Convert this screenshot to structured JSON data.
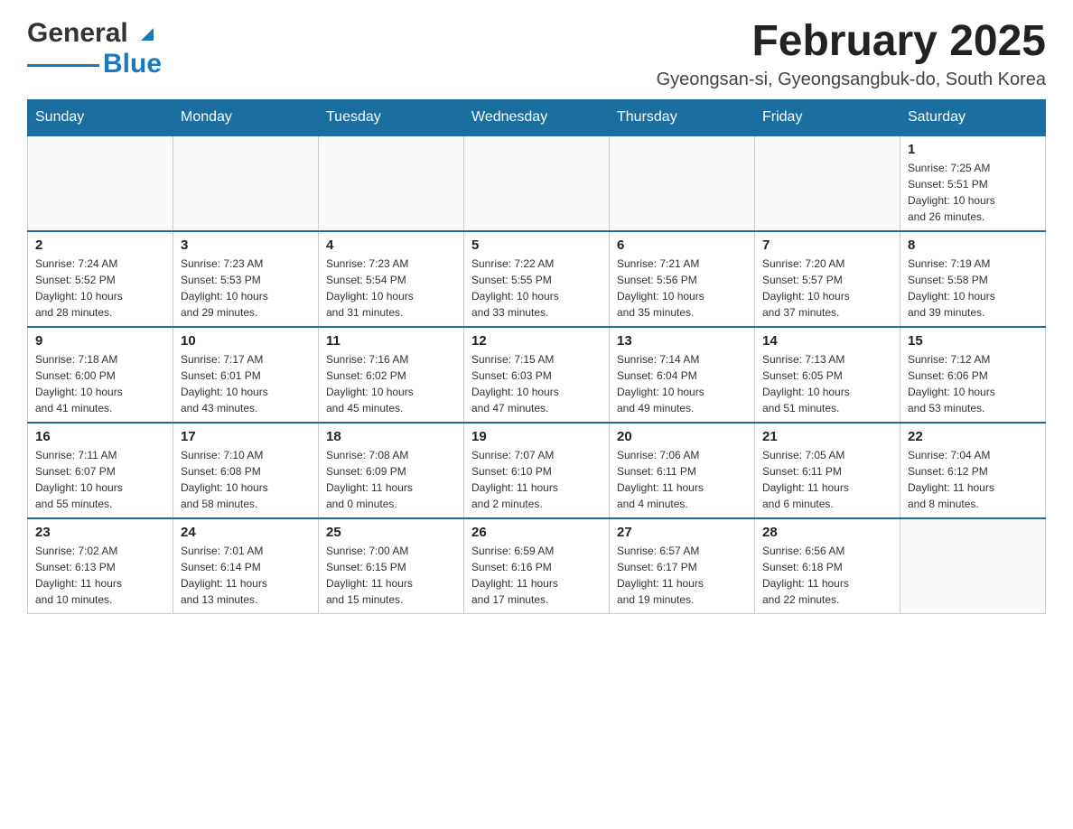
{
  "header": {
    "logo_general": "General",
    "logo_blue": "Blue",
    "title": "February 2025",
    "subtitle": "Gyeongsan-si, Gyeongsangbuk-do, South Korea"
  },
  "weekdays": [
    "Sunday",
    "Monday",
    "Tuesday",
    "Wednesday",
    "Thursday",
    "Friday",
    "Saturday"
  ],
  "weeks": [
    [
      {
        "day": "",
        "info": ""
      },
      {
        "day": "",
        "info": ""
      },
      {
        "day": "",
        "info": ""
      },
      {
        "day": "",
        "info": ""
      },
      {
        "day": "",
        "info": ""
      },
      {
        "day": "",
        "info": ""
      },
      {
        "day": "1",
        "info": "Sunrise: 7:25 AM\nSunset: 5:51 PM\nDaylight: 10 hours\nand 26 minutes."
      }
    ],
    [
      {
        "day": "2",
        "info": "Sunrise: 7:24 AM\nSunset: 5:52 PM\nDaylight: 10 hours\nand 28 minutes."
      },
      {
        "day": "3",
        "info": "Sunrise: 7:23 AM\nSunset: 5:53 PM\nDaylight: 10 hours\nand 29 minutes."
      },
      {
        "day": "4",
        "info": "Sunrise: 7:23 AM\nSunset: 5:54 PM\nDaylight: 10 hours\nand 31 minutes."
      },
      {
        "day": "5",
        "info": "Sunrise: 7:22 AM\nSunset: 5:55 PM\nDaylight: 10 hours\nand 33 minutes."
      },
      {
        "day": "6",
        "info": "Sunrise: 7:21 AM\nSunset: 5:56 PM\nDaylight: 10 hours\nand 35 minutes."
      },
      {
        "day": "7",
        "info": "Sunrise: 7:20 AM\nSunset: 5:57 PM\nDaylight: 10 hours\nand 37 minutes."
      },
      {
        "day": "8",
        "info": "Sunrise: 7:19 AM\nSunset: 5:58 PM\nDaylight: 10 hours\nand 39 minutes."
      }
    ],
    [
      {
        "day": "9",
        "info": "Sunrise: 7:18 AM\nSunset: 6:00 PM\nDaylight: 10 hours\nand 41 minutes."
      },
      {
        "day": "10",
        "info": "Sunrise: 7:17 AM\nSunset: 6:01 PM\nDaylight: 10 hours\nand 43 minutes."
      },
      {
        "day": "11",
        "info": "Sunrise: 7:16 AM\nSunset: 6:02 PM\nDaylight: 10 hours\nand 45 minutes."
      },
      {
        "day": "12",
        "info": "Sunrise: 7:15 AM\nSunset: 6:03 PM\nDaylight: 10 hours\nand 47 minutes."
      },
      {
        "day": "13",
        "info": "Sunrise: 7:14 AM\nSunset: 6:04 PM\nDaylight: 10 hours\nand 49 minutes."
      },
      {
        "day": "14",
        "info": "Sunrise: 7:13 AM\nSunset: 6:05 PM\nDaylight: 10 hours\nand 51 minutes."
      },
      {
        "day": "15",
        "info": "Sunrise: 7:12 AM\nSunset: 6:06 PM\nDaylight: 10 hours\nand 53 minutes."
      }
    ],
    [
      {
        "day": "16",
        "info": "Sunrise: 7:11 AM\nSunset: 6:07 PM\nDaylight: 10 hours\nand 55 minutes."
      },
      {
        "day": "17",
        "info": "Sunrise: 7:10 AM\nSunset: 6:08 PM\nDaylight: 10 hours\nand 58 minutes."
      },
      {
        "day": "18",
        "info": "Sunrise: 7:08 AM\nSunset: 6:09 PM\nDaylight: 11 hours\nand 0 minutes."
      },
      {
        "day": "19",
        "info": "Sunrise: 7:07 AM\nSunset: 6:10 PM\nDaylight: 11 hours\nand 2 minutes."
      },
      {
        "day": "20",
        "info": "Sunrise: 7:06 AM\nSunset: 6:11 PM\nDaylight: 11 hours\nand 4 minutes."
      },
      {
        "day": "21",
        "info": "Sunrise: 7:05 AM\nSunset: 6:11 PM\nDaylight: 11 hours\nand 6 minutes."
      },
      {
        "day": "22",
        "info": "Sunrise: 7:04 AM\nSunset: 6:12 PM\nDaylight: 11 hours\nand 8 minutes."
      }
    ],
    [
      {
        "day": "23",
        "info": "Sunrise: 7:02 AM\nSunset: 6:13 PM\nDaylight: 11 hours\nand 10 minutes."
      },
      {
        "day": "24",
        "info": "Sunrise: 7:01 AM\nSunset: 6:14 PM\nDaylight: 11 hours\nand 13 minutes."
      },
      {
        "day": "25",
        "info": "Sunrise: 7:00 AM\nSunset: 6:15 PM\nDaylight: 11 hours\nand 15 minutes."
      },
      {
        "day": "26",
        "info": "Sunrise: 6:59 AM\nSunset: 6:16 PM\nDaylight: 11 hours\nand 17 minutes."
      },
      {
        "day": "27",
        "info": "Sunrise: 6:57 AM\nSunset: 6:17 PM\nDaylight: 11 hours\nand 19 minutes."
      },
      {
        "day": "28",
        "info": "Sunrise: 6:56 AM\nSunset: 6:18 PM\nDaylight: 11 hours\nand 22 minutes."
      },
      {
        "day": "",
        "info": ""
      }
    ]
  ]
}
